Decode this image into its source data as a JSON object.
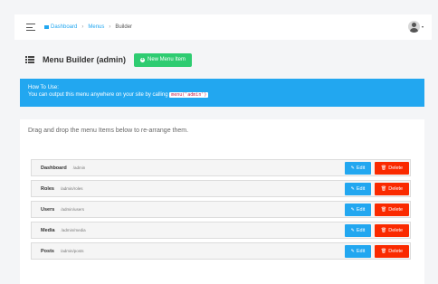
{
  "breadcrumb": {
    "home": "Dashboard",
    "menus": "Menus",
    "current": "Builder",
    "separator": "›"
  },
  "icons": {
    "menu": "hamburger-icon",
    "home": "home-icon",
    "avatar": "user-avatar",
    "caret": "caret-down-icon",
    "list": "list-icon",
    "plus": "plus-circle-icon",
    "edit": "pencil-icon",
    "delete": "trash-icon"
  },
  "caret": "▾",
  "header": {
    "title": "Menu Builder (admin)",
    "new_button": "New Menu Item",
    "plus": "+"
  },
  "alert": {
    "heading": "How To Use:",
    "text": "You can output this menu anywhere on your site by calling",
    "code": "menu('admin')"
  },
  "panel": {
    "intro": "Drag and drop the menu Items below to re-arrange them."
  },
  "buttons": {
    "edit": "Edit",
    "delete": "Delete",
    "edit_glyph": "✎",
    "delete_glyph": "🗑"
  },
  "items": [
    {
      "title": "Dashboard",
      "url": "/admin"
    },
    {
      "title": "Roles",
      "url": "/admin/roles"
    },
    {
      "title": "Users",
      "url": "/admin/users"
    },
    {
      "title": "Media",
      "url": "/admin/media"
    },
    {
      "title": "Posts",
      "url": "/admin/posts"
    }
  ],
  "colors": {
    "primary": "#22a7f0",
    "success": "#2ecc71",
    "danger": "#fa2a00",
    "background": "#f4f5f7"
  }
}
